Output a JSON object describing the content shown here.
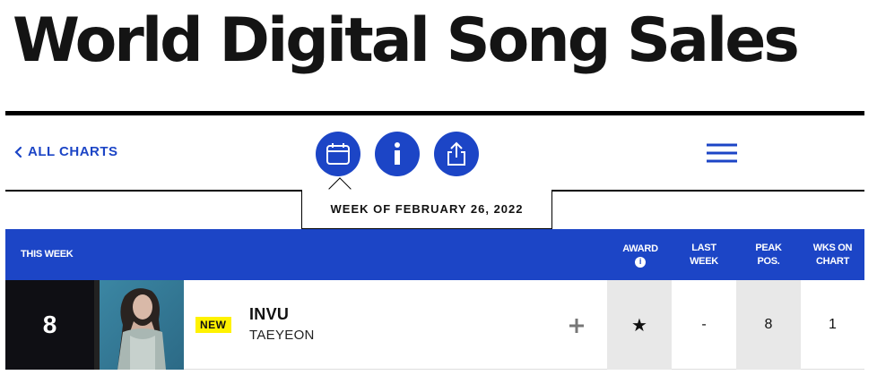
{
  "page": {
    "title": "World Digital Song Sales"
  },
  "nav": {
    "all_charts_label": "ALL CHARTS",
    "buttons": [
      {
        "name": "calendar",
        "icon": "calendar-icon"
      },
      {
        "name": "info",
        "icon": "info-icon"
      },
      {
        "name": "share",
        "icon": "share-icon"
      }
    ],
    "menu_icon": "hamburger-menu-icon",
    "week_label": "WEEK OF FEBRUARY 26, 2022"
  },
  "colors": {
    "accent": "#1c45c6",
    "rank_bg": "#0f0f14",
    "new_badge": "#fff200",
    "stat_grey": "#e8e8e8"
  },
  "table": {
    "headers": {
      "this_week": "THIS WEEK",
      "award_1": "AWARD",
      "award_info": "i",
      "last_1": "LAST",
      "last_2": "WEEK",
      "peak_1": "PEAK",
      "peak_2": "POS.",
      "wks_1": "WKS ON",
      "wks_2": "CHART"
    },
    "rows": [
      {
        "rank": "8",
        "badge": "NEW",
        "title": "INVU",
        "artist": "TAEYEON",
        "award": "★",
        "last_week": "-",
        "peak_pos": "8",
        "wks_on_chart": "1",
        "add_icon": "plus-icon"
      }
    ]
  }
}
